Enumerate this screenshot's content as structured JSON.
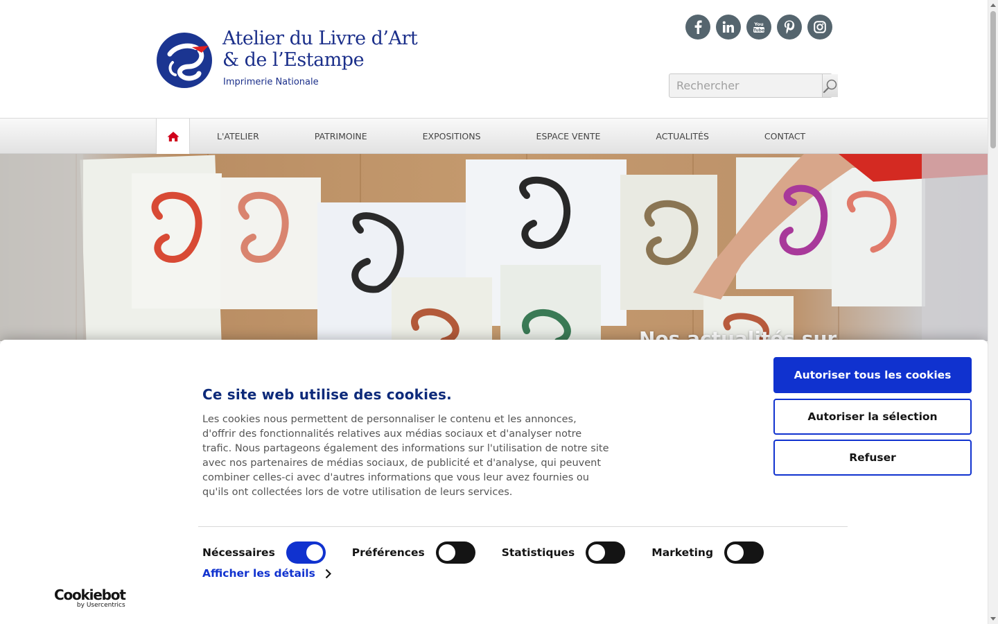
{
  "header": {
    "logo": {
      "line1": "Atelier du Livre d’Art",
      "line2": "& de l’Estampe",
      "line3": "Imprimerie Nationale"
    },
    "social": [
      {
        "name": "facebook-icon",
        "glyph": "f"
      },
      {
        "name": "linkedin-icon",
        "glyph": "in"
      },
      {
        "name": "youtube-icon",
        "glyph": "You Tube"
      },
      {
        "name": "pinterest-icon",
        "glyph": "P"
      },
      {
        "name": "instagram-icon",
        "glyph": ""
      }
    ],
    "search": {
      "placeholder": "Rechercher",
      "icon": "search-icon"
    }
  },
  "nav": {
    "home_icon": "home-icon",
    "items": [
      "L'ATELIER",
      "PATRIMOINE",
      "EXPOSITIONS",
      "ESPACE VENTE",
      "ACTUALITÉS",
      "CONTACT"
    ],
    "home_color": "#d0021b"
  },
  "hero": {
    "caption": "Nos actualités sur"
  },
  "cookie_banner": {
    "title": "Ce site web utilise des cookies.",
    "text": "Les cookies nous permettent de personnaliser le contenu et les annonces, d'offrir des fonctionnalités relatives aux médias sociaux et d'analyser notre trafic. Nous partageons également des informations sur l'utilisation de notre site avec nos partenaires de médias sociaux, de publicité et d'analyse, qui peuvent combiner celles-ci avec d'autres informations que vous leur avez fournies ou qu'ils ont collectées lors de votre utilisation de leurs services.",
    "buttons": {
      "allow_all": "Autoriser tous les cookies",
      "allow_selection": "Autoriser la sélection",
      "refuse": "Refuser"
    },
    "toggles": [
      {
        "label": "Nécessaires",
        "on": true
      },
      {
        "label": "Préférences",
        "on": false
      },
      {
        "label": "Statistiques",
        "on": false
      },
      {
        "label": "Marketing",
        "on": false
      }
    ],
    "details_link": "Afficher les détails",
    "brand": {
      "name": "Cookiebot",
      "sub": "by Usercentrics"
    },
    "accent_color": "#1032cf",
    "title_color": "#0d2a7a"
  }
}
